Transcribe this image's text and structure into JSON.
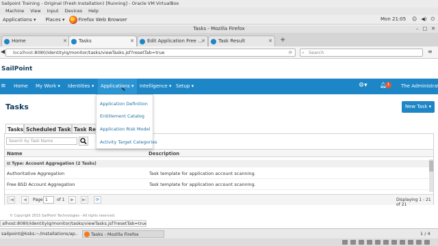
{
  "vbox": {
    "title": "Sailpoint Training - Original (Fresh Installation) [Running] - Oracle VM VirtualBox",
    "menu": [
      "Machine",
      "View",
      "Input",
      "Devices",
      "Help"
    ]
  },
  "gnome": {
    "applications": "Applications",
    "places": "Places",
    "browser": "Firefox Web Browser",
    "clock": "Mon 21:05"
  },
  "firefox": {
    "window_title": "Tasks - Mozilla Firefox",
    "tabs": [
      {
        "label": "Home"
      },
      {
        "label": "Tasks"
      },
      {
        "label": "Edit Application Free ..."
      },
      {
        "label": "Task Result"
      }
    ],
    "url_host": "localhost",
    "url_path": ":8080/identityiq/monitor/tasks/viewTasks.jsf?resetTab=true",
    "search_placeholder": "Search",
    "status_url": "alhost:8080/identityiq/monitor/tasks/viewTasks.jsf?resetTab=true#"
  },
  "sailpoint": {
    "logo": "SailPoint",
    "nav": {
      "home": "Home",
      "my_work": "My Work",
      "identities": "Identities",
      "applications": "Applications",
      "intelligence": "Intelligence",
      "setup": "Setup",
      "notification_count": "1",
      "user": "The Administrator"
    },
    "applications_menu": [
      "Application Definition",
      "Entitlement Catalog",
      "Application Risk Model",
      "Activity Target Categories"
    ],
    "page_title": "Tasks",
    "new_task": "New Task",
    "tabs": [
      "Tasks",
      "Scheduled Tasks",
      "Task Results"
    ],
    "filter_placeholder": "Search by Task Name",
    "columns": {
      "name": "Name",
      "description": "Description"
    },
    "group_label": "Type: Account Aggregation (2 Tasks)",
    "rows": [
      {
        "name": "Authoritative Aggregation",
        "description": "Task template for application account scanning."
      },
      {
        "name": "Free BSD Account Aggregation",
        "description": "Task template for application account scanning."
      }
    ],
    "pager": {
      "page_label": "Page",
      "page_value": "1",
      "of": "of 1",
      "displaying": "Displaying 1 - 21 of 21"
    },
    "copyright": "© Copyright 2015 SailPoint Technologies - All rights reserved."
  },
  "taskbar": {
    "terminal": "sailpoint@ksks:~/Installations/ap...",
    "firefox": "Tasks - Mozilla Firefox",
    "workspace": "1 / 4"
  }
}
